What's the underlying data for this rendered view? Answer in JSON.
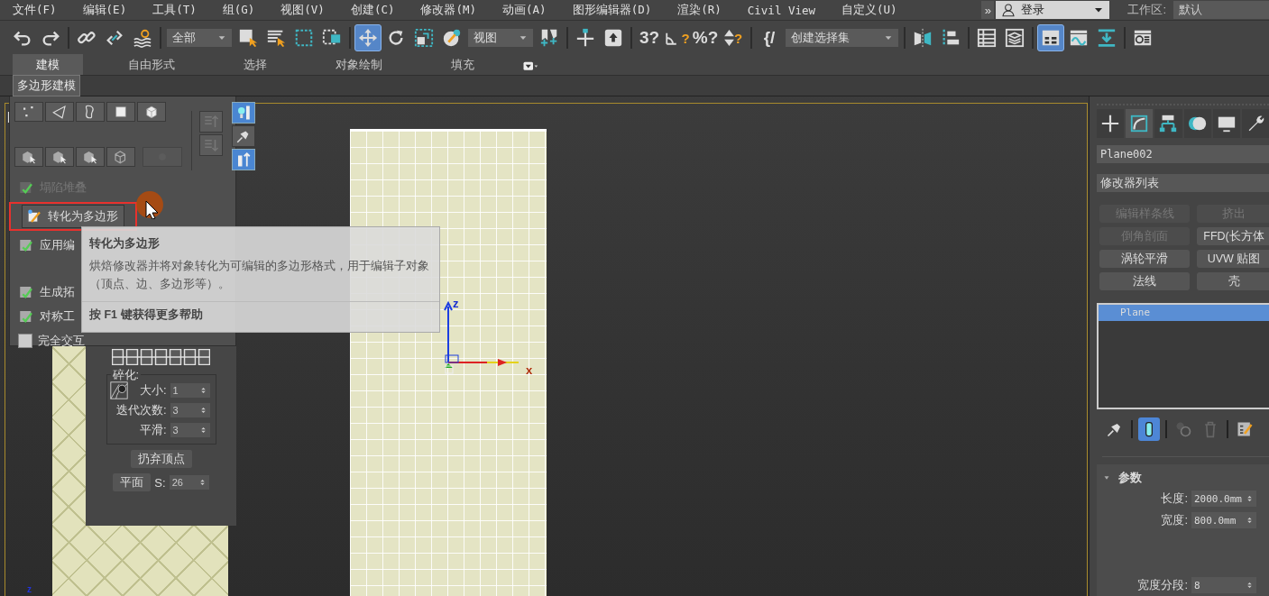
{
  "menu_bar": {
    "items": [
      "文件(F)",
      "编辑(E)",
      "工具(T)",
      "组(G)",
      "视图(V)",
      "创建(C)",
      "修改器(M)",
      "动画(A)",
      "图形编辑器(D)",
      "渲染(R)",
      "Civil View",
      "自定义(U)"
    ],
    "overflow": "»",
    "login": "登录",
    "workspace_label": "工作区:",
    "workspace": "默认"
  },
  "toolbar": {
    "items": [
      {
        "kind": "undo",
        "selected": false
      },
      {
        "kind": "redo",
        "selected": false
      },
      {
        "kind": "separator"
      },
      {
        "kind": "link",
        "selected": false
      },
      {
        "kind": "unlink",
        "selected": false
      },
      {
        "kind": "bind",
        "selected": false
      },
      {
        "kind": "separator"
      },
      {
        "kind": "dropdown",
        "value": "全部"
      },
      {
        "kind": "select-object",
        "selected": false
      },
      {
        "kind": "select-by-name",
        "selected": false
      },
      {
        "kind": "region",
        "selected": false
      },
      {
        "kind": "crossing",
        "selected": false
      },
      {
        "kind": "separator"
      },
      {
        "kind": "move",
        "selected": true
      },
      {
        "kind": "rotate",
        "selected": false
      },
      {
        "kind": "scale",
        "selected": false
      },
      {
        "kind": "placement",
        "selected": false
      },
      {
        "kind": "dropdown",
        "value": "视图"
      },
      {
        "kind": "pivot",
        "selected": false
      },
      {
        "kind": "separator"
      },
      {
        "kind": "manipulate",
        "selected": false
      },
      {
        "kind": "keyboard",
        "selected": false
      },
      {
        "kind": "separator"
      },
      {
        "kind": "glyph",
        "glyph": "3?",
        "selected": false
      },
      {
        "kind": "angle-snap",
        "glyph": "?",
        "selected": false
      },
      {
        "kind": "glyph",
        "glyph": "%?",
        "selected": false
      },
      {
        "kind": "spinner-snap",
        "glyph": "?",
        "selected": false
      },
      {
        "kind": "separator"
      },
      {
        "kind": "glyph",
        "glyph": "{/",
        "selected": false
      },
      {
        "kind": "dropdown",
        "value": "创建选择集"
      },
      {
        "kind": "separator"
      },
      {
        "kind": "mirror",
        "selected": false
      },
      {
        "kind": "align",
        "selected": false
      },
      {
        "kind": "separator"
      },
      {
        "kind": "table",
        "selected": false
      },
      {
        "kind": "layers",
        "selected": false
      },
      {
        "kind": "separator"
      },
      {
        "kind": "ribbon",
        "selected": true
      },
      {
        "kind": "curve",
        "selected": false
      },
      {
        "kind": "download",
        "selected": false
      },
      {
        "kind": "separator"
      },
      {
        "kind": "render",
        "selected": false
      }
    ]
  },
  "ribbon": {
    "tabs": [
      {
        "label": "建模",
        "selected": true
      },
      {
        "label": "自由形式",
        "selected": false
      },
      {
        "label": "选择",
        "selected": false
      },
      {
        "label": "对象绘制",
        "selected": false
      },
      {
        "label": "填充",
        "selected": false
      }
    ],
    "panel_tab": "多边形建模"
  },
  "ribbon_panel": {
    "subobjects": [
      {
        "kind": "vertex",
        "selected": false
      },
      {
        "kind": "edge",
        "selected": false
      },
      {
        "kind": "border",
        "selected": false
      },
      {
        "kind": "polygon",
        "selected": false
      },
      {
        "kind": "element",
        "selected": false
      }
    ],
    "selection_tools": [
      {
        "kind": "cube",
        "disabled": false
      },
      {
        "kind": "cube",
        "disabled": false
      },
      {
        "kind": "cube",
        "disabled": false
      },
      {
        "kind": "wire",
        "disabled": false
      },
      {
        "kind": "circle",
        "disabled": true
      }
    ],
    "stack_tools": [
      {
        "kind": "up",
        "selected": false
      },
      {
        "kind": "down",
        "selected": false
      }
    ],
    "view_tools": [
      {
        "kind": "bulb",
        "selected": true
      },
      {
        "kind": "pin",
        "selected": false
      },
      {
        "kind": "tube",
        "selected": true
      }
    ],
    "commands": [
      {
        "kind": "item",
        "label": "塌陷堆叠",
        "disabled": true
      },
      {
        "kind": "button",
        "label": "转化为多边形",
        "disabled": false,
        "highlighted": true
      },
      {
        "kind": "item",
        "label": "应用编",
        "disabled": false
      },
      {
        "kind": "spacer"
      },
      {
        "kind": "item",
        "label": "生成拓",
        "disabled": false
      },
      {
        "kind": "item",
        "label": "对称工",
        "disabled": false
      },
      {
        "kind": "checkbox",
        "label": "完全交互",
        "checked": false
      }
    ]
  },
  "tooltip": {
    "title": "转化为多边形",
    "body": "烘焙修改器并将对象转化为可编辑的多边形格式，用于编辑子对象（顶点、边、多边形等）。",
    "help": "按 F1 键获得更多帮助"
  },
  "tessellate_panel": {
    "group": "碎化:",
    "fields": [
      {
        "label": "大小:",
        "value": "1"
      },
      {
        "label": "迭代次数:",
        "value": "3"
      },
      {
        "label": "平滑:",
        "value": "3"
      }
    ],
    "discard_button": "扔弃顶点",
    "plane_button": "平面",
    "s_label": "S:",
    "s_value": "26"
  },
  "viewport": {
    "label": "[",
    "axis_labels": [
      "z",
      "x"
    ],
    "corner_axis": "z"
  },
  "command_panel": {
    "tabs": [
      {
        "kind": "create",
        "selected": false
      },
      {
        "kind": "modify",
        "selected": true
      },
      {
        "kind": "hierarchy",
        "selected": false
      },
      {
        "kind": "motion",
        "selected": false
      },
      {
        "kind": "display",
        "selected": false
      },
      {
        "kind": "utilities",
        "selected": false
      }
    ],
    "object_name": "Plane002",
    "modifier_list": "修改器列表",
    "modifier_buttons": [
      {
        "label": "编辑样条线",
        "disabled": true
      },
      {
        "label": "挤出",
        "disabled": true
      },
      {
        "label": "倒角剖面",
        "disabled": true
      },
      {
        "label": "FFD(长方体",
        "disabled": false
      },
      {
        "label": "涡轮平滑",
        "disabled": false
      },
      {
        "label": "UVW 贴图",
        "disabled": false
      },
      {
        "label": "法线",
        "disabled": false
      },
      {
        "label": "壳",
        "disabled": false
      }
    ],
    "stack": [
      {
        "label": "Plane",
        "selected": true
      }
    ],
    "stack_tools": [
      {
        "kind": "pin",
        "selected": false
      },
      {
        "kind": "separator"
      },
      {
        "kind": "end-result",
        "selected": true
      },
      {
        "kind": "separator"
      },
      {
        "kind": "unique",
        "selected": false
      },
      {
        "kind": "remove",
        "selected": false
      },
      {
        "kind": "separator"
      },
      {
        "kind": "configure",
        "selected": false
      }
    ],
    "rollout": {
      "title": "参数",
      "expanded": true,
      "fields": [
        {
          "label": "长度:",
          "value": "2000.0mm"
        },
        {
          "label": "宽度:",
          "value": "800.0mm"
        },
        {
          "kind": "hidden"
        },
        {
          "label": "宽度分段:",
          "value": "8"
        }
      ]
    }
  }
}
